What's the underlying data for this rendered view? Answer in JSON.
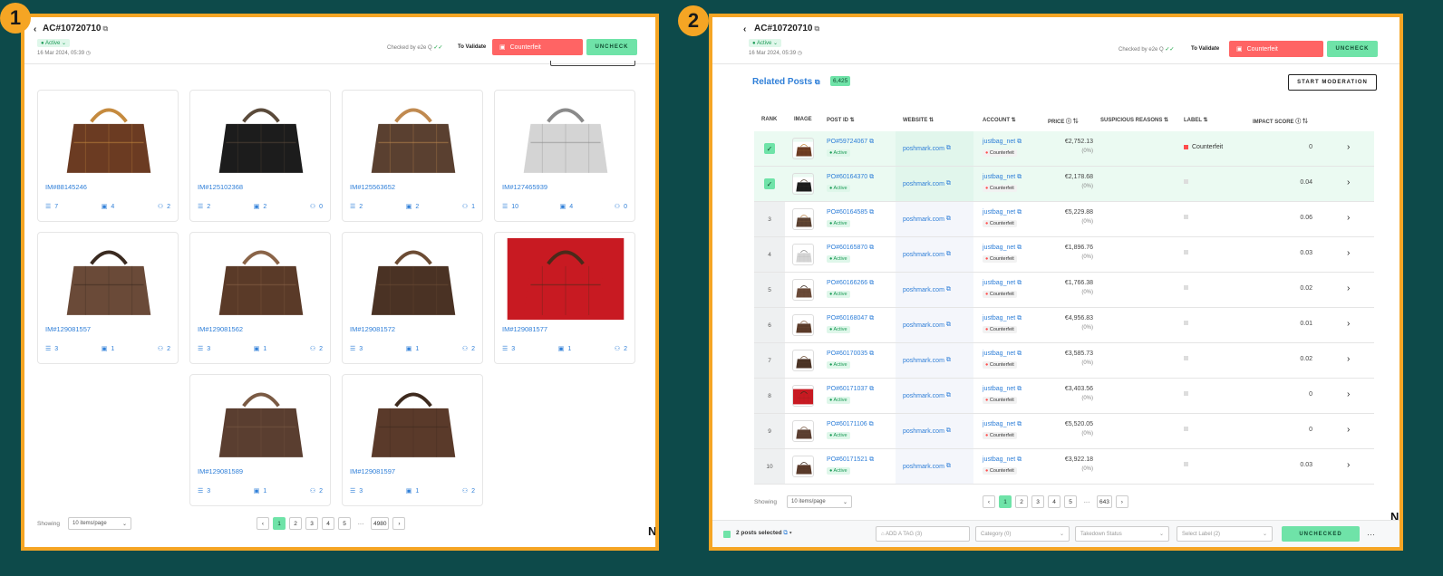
{
  "badges": {
    "one": "1",
    "two": "2"
  },
  "header": {
    "ac_id": "AC#10720710",
    "status": "● Active ⌄",
    "date": "16 Mar 2024, 05:39",
    "checked_by": "Checked by e2e Q",
    "to_validate": "To Validate",
    "label": "Counterfeit",
    "uncheck": "UNCHECK"
  },
  "panel1": {
    "cards": [
      {
        "id": "IM#88145246",
        "a": "7",
        "b": "4",
        "c": "2"
      },
      {
        "id": "IM#125102368",
        "a": "2",
        "b": "2",
        "c": "0"
      },
      {
        "id": "IM#125563652",
        "a": "2",
        "b": "2",
        "c": "1"
      },
      {
        "id": "IM#127465939",
        "a": "10",
        "b": "4",
        "c": "0"
      },
      {
        "id": "IM#129081557",
        "a": "3",
        "b": "1",
        "c": "2"
      },
      {
        "id": "IM#129081562",
        "a": "3",
        "b": "1",
        "c": "2"
      },
      {
        "id": "IM#129081572",
        "a": "3",
        "b": "1",
        "c": "2"
      },
      {
        "id": "IM#129081577",
        "a": "3",
        "b": "1",
        "c": "2"
      },
      {
        "id": "IM#129081589",
        "a": "3",
        "b": "1",
        "c": "2"
      },
      {
        "id": "IM#129081597",
        "a": "3",
        "b": "1",
        "c": "2"
      }
    ],
    "showing": "Showing",
    "per_page": "10 items/page",
    "pages": [
      "1",
      "2",
      "3",
      "4",
      "5"
    ],
    "last_page": "4980"
  },
  "panel2": {
    "related_title": "Related Posts",
    "related_count": "6,425",
    "start_moderation": "START MODERATION",
    "columns": {
      "rank": "RANK",
      "image": "IMAGE",
      "post_id": "POST ID",
      "website": "WEBSITE",
      "account": "ACCOUNT",
      "price": "PRICE",
      "suspicious": "SUSPICIOUS REASONS",
      "label": "LABEL",
      "impact": "IMPACT SCORE"
    },
    "rows": [
      {
        "rank": "",
        "post": "PO#59724067",
        "status": "● Active",
        "website": "poshmark.com",
        "account": "justbag_net",
        "acc_label": "Counterfeit",
        "price": "€2,752.13",
        "pct": "(0%)",
        "label": "Counterfeit",
        "score": "0"
      },
      {
        "rank": "",
        "post": "PO#60164370",
        "status": "● Active",
        "website": "poshmark.com",
        "account": "justbag_net",
        "acc_label": "Counterfeit",
        "price": "€2,178.68",
        "pct": "(0%)",
        "label": "",
        "score": "0.04"
      },
      {
        "rank": "3",
        "post": "PO#60164585",
        "status": "● Active",
        "website": "poshmark.com",
        "account": "justbag_net",
        "acc_label": "Counterfeit",
        "price": "€5,229.88",
        "pct": "(0%)",
        "label": "",
        "score": "0.06"
      },
      {
        "rank": "4",
        "post": "PO#60165870",
        "status": "● Active",
        "website": "poshmark.com",
        "account": "justbag_net",
        "acc_label": "Counterfeit",
        "price": "€1,896.76",
        "pct": "(0%)",
        "label": "",
        "score": "0.03"
      },
      {
        "rank": "5",
        "post": "PO#60166266",
        "status": "● Active",
        "website": "poshmark.com",
        "account": "justbag_net",
        "acc_label": "Counterfeit",
        "price": "€1,766.38",
        "pct": "(0%)",
        "label": "",
        "score": "0.02"
      },
      {
        "rank": "6",
        "post": "PO#60168047",
        "status": "● Active",
        "website": "poshmark.com",
        "account": "justbag_net",
        "acc_label": "Counterfeit",
        "price": "€4,956.83",
        "pct": "(0%)",
        "label": "",
        "score": "0.01"
      },
      {
        "rank": "7",
        "post": "PO#60170035",
        "status": "● Active",
        "website": "poshmark.com",
        "account": "justbag_net",
        "acc_label": "Counterfeit",
        "price": "€3,585.73",
        "pct": "(0%)",
        "label": "",
        "score": "0.02"
      },
      {
        "rank": "8",
        "post": "PO#60171037",
        "status": "● Active",
        "website": "poshmark.com",
        "account": "justbag_net",
        "acc_label": "Counterfeit",
        "price": "€3,403.56",
        "pct": "(0%)",
        "label": "",
        "score": "0"
      },
      {
        "rank": "9",
        "post": "PO#60171106",
        "status": "● Active",
        "website": "poshmark.com",
        "account": "justbag_net",
        "acc_label": "Counterfeit",
        "price": "€5,520.05",
        "pct": "(0%)",
        "label": "",
        "score": "0"
      },
      {
        "rank": "10",
        "post": "PO#60171521",
        "status": "● Active",
        "website": "poshmark.com",
        "account": "justbag_net",
        "acc_label": "Counterfeit",
        "price": "€3,922.18",
        "pct": "(0%)",
        "label": "",
        "score": "0.03"
      }
    ],
    "showing": "Showing",
    "per_page": "10 items/page",
    "pages": [
      "1",
      "2",
      "3",
      "4",
      "5"
    ],
    "last_page": "643",
    "bottom": {
      "selected": "2 posts selected",
      "tag": "ADD A TAG (3)",
      "category": "Category (0)",
      "takedown": "Takedown Status",
      "select_label": "Select Label (2)",
      "unchecked": "UNCHECKED",
      "more": "···"
    }
  },
  "corner_n": "N"
}
